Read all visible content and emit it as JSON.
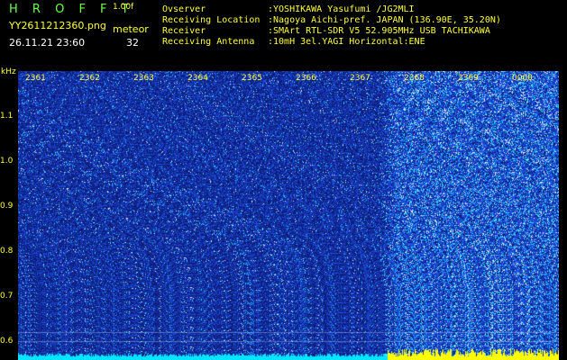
{
  "header": {
    "title": "H R O F F T",
    "version": "1.00f",
    "filename": "YY2611212360.png",
    "meteor_label": "meteor",
    "datetime": "26.11.21 23:60",
    "meteor_count": "32"
  },
  "info": {
    "observer_label": "Ovserver",
    "observer_value": ":YOSHIKAWA Yasufumi /JG2MLI",
    "location_label": "Receiving Location",
    "location_value": ":Nagoya Aichi-pref. JAPAN (136.90E, 35.20N)",
    "receiver_label": "Receiver",
    "receiver_value": ":SMArt RTL-SDR V5 52.905MHz USB TACHIKAWA",
    "antenna_label": "Receiving Antenna",
    "antenna_value": ":10mH 3el.YAGI Horizontal:ENE"
  },
  "axis": {
    "y_unit": "kHz",
    "y_ticks": [
      "1.1",
      "1.0",
      "0.9",
      "0.8",
      "0.7",
      "0.6"
    ],
    "x_ticks": [
      "2361",
      "2362",
      "2363",
      "2364",
      "2365",
      "2366",
      "2367",
      "2368",
      "2369",
      "0000"
    ]
  },
  "colors": {
    "background": "#000000",
    "waterfall_base": "#0c1a80",
    "noise_blue": "#2a5cff",
    "noise_cyan": "#2ee0ff",
    "noise_white": "#e8f4ff",
    "baseline": "#00e5ff",
    "baseline_hot": "#ffff00",
    "label_green": "#6cff4f",
    "label_yellow": "#ffff3a"
  }
}
